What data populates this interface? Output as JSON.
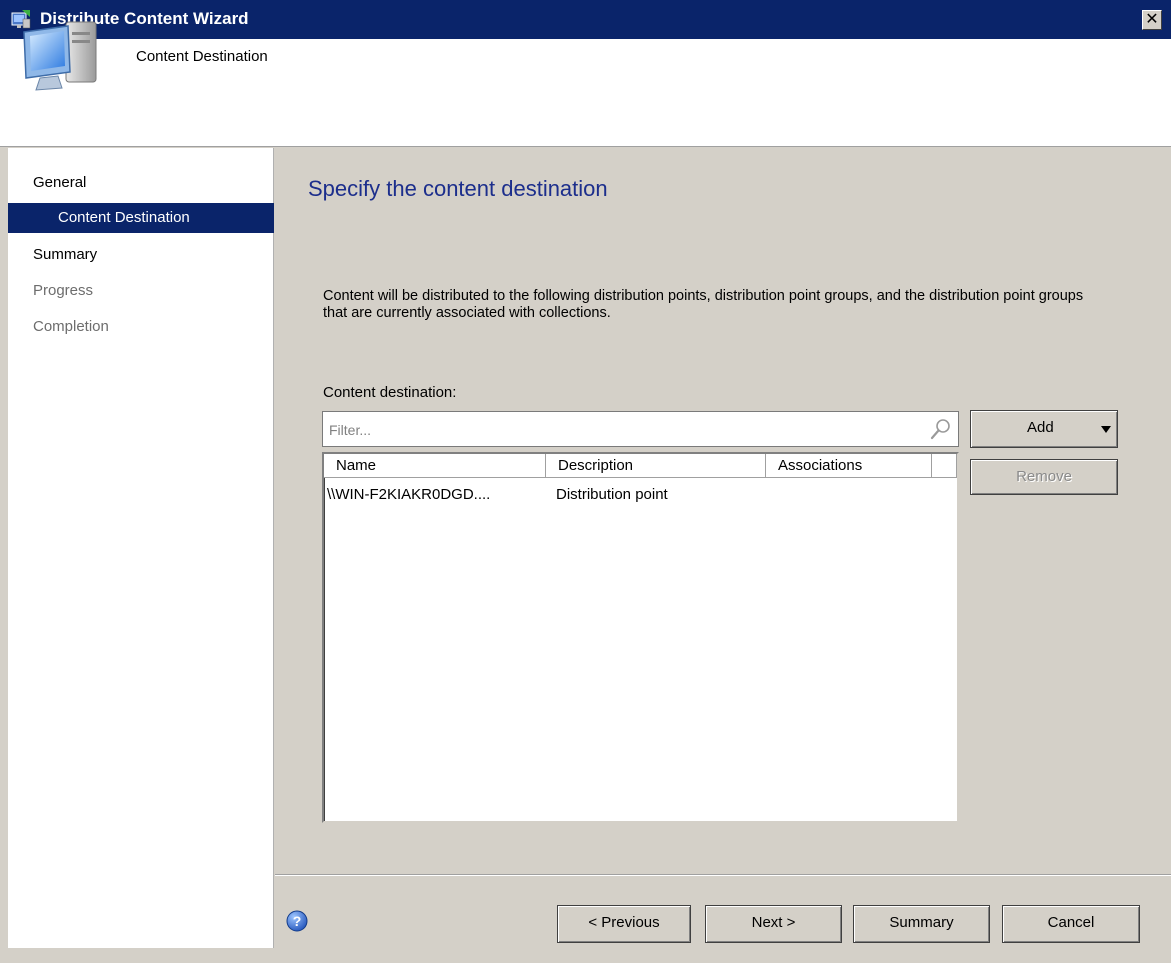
{
  "window": {
    "title": "Distribute Content Wizard",
    "close_glyph": "✕"
  },
  "header": {
    "title": "Content Destination"
  },
  "nav": {
    "items": [
      {
        "label": "General",
        "state": "done"
      },
      {
        "label": "Content Destination",
        "state": "active"
      },
      {
        "label": "Summary",
        "state": "done"
      },
      {
        "label": "Progress",
        "state": "pending"
      },
      {
        "label": "Completion",
        "state": "pending"
      }
    ]
  },
  "main": {
    "heading": "Specify the content destination",
    "description": "Content will be distributed to the following distribution points, distribution point groups, and the distribution point groups that are currently associated with collections.",
    "destination_label": "Content destination:",
    "filter_placeholder": "Filter...",
    "table": {
      "columns": [
        "Name",
        "Description",
        "Associations"
      ],
      "rows": [
        [
          "\\\\WIN-F2KIAKR0DGD....",
          "Distribution point",
          ""
        ]
      ]
    },
    "add_label": "Add",
    "remove_label": "Remove"
  },
  "footer": {
    "previous_label": "< Previous",
    "next_label": "Next >",
    "summary_label": "Summary",
    "cancel_label": "Cancel"
  },
  "colors": {
    "titlebar": "#0a246a",
    "nav_active": "#0a246a",
    "heading": "#1c2e8c",
    "window_bg": "#d4d0c8"
  },
  "icons": {
    "title": "wizard-icon",
    "header": "computer-icon",
    "search": "search-icon",
    "help": "help-icon",
    "add_dropdown": "dropdown-arrow-icon"
  }
}
